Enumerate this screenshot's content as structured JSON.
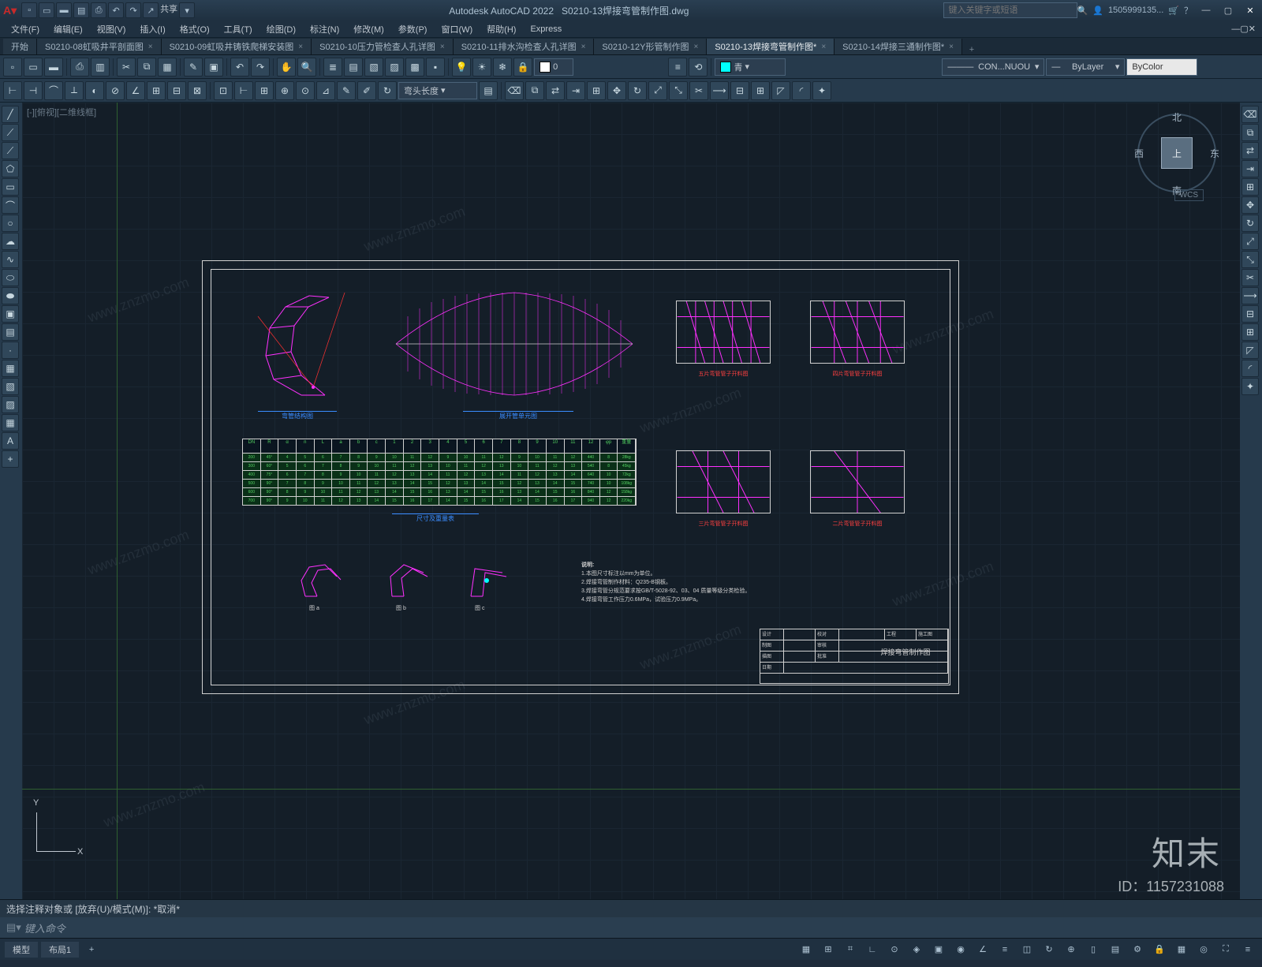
{
  "app": {
    "title": "Autodesk AutoCAD 2022",
    "filename": "S0210-13焊接弯管制作图.dwg",
    "share": "共享"
  },
  "search": {
    "placeholder": "键入关键字或短语",
    "user": "1505999135..."
  },
  "menu": [
    "文件(F)",
    "编辑(E)",
    "视图(V)",
    "插入(I)",
    "格式(O)",
    "工具(T)",
    "绘图(D)",
    "标注(N)",
    "修改(M)",
    "参数(P)",
    "窗口(W)",
    "帮助(H)",
    "Express"
  ],
  "tabs": {
    "start": "开始",
    "items": [
      {
        "label": "S0210-08虹吸井平剖面图"
      },
      {
        "label": "S0210-09虹吸井铸铁爬梯安装图"
      },
      {
        "label": "S0210-10压力管检查人孔详图"
      },
      {
        "label": "S0210-11排水沟检查人孔详图"
      },
      {
        "label": "S0210-12Y形管制作图"
      },
      {
        "label": "S0210-13焊接弯管制作图*"
      },
      {
        "label": "S0210-14焊接三通制作图*"
      }
    ],
    "active_index": 5
  },
  "props": {
    "linetype": "CON...NUOU",
    "lineweight": "ByLayer",
    "color": "ByColor",
    "layer_color": "青",
    "layer_num": "0",
    "combo": "弯头长度"
  },
  "viewport": {
    "label": "[-][俯视][二维线框]"
  },
  "viewcube": {
    "top": "上",
    "n": "北",
    "s": "南",
    "e": "东",
    "w": "西",
    "wcs": "WCS"
  },
  "drawing": {
    "labels": {
      "elbow": "弯管结构图",
      "unfold": "展开管单元图",
      "table": "尺寸及重量表",
      "db1": "五片弯管管子开料图",
      "db2": "四片弯管管子开料图",
      "db3": "三片弯管管子开料图",
      "db4": "二片弯管管子开料图",
      "sa": "图 a",
      "sb": "图 b",
      "sc": "图 c"
    },
    "notes": {
      "title": "说明:",
      "n1": "1.本图尺寸标注以mm为单位。",
      "n2": "2.焊接弯管制作材料：Q235-B钢板。",
      "n3": "3.焊接弯管分规范要求按GB/T-5028-92、03、04 质量等级分类检验。",
      "n4": "4.焊接弯管工作压力0.6MPa，试验压力0.9MPa。"
    },
    "title_block": {
      "project": "工程",
      "stage": "施工图",
      "main": "焊接弯管制作图"
    }
  },
  "cmd": {
    "history": "选择注释对象或  [放弃(U)/模式(M)]:  *取消*",
    "prompt": "键入命令"
  },
  "status": {
    "model": "模型",
    "layout": "布局1"
  },
  "watermark": {
    "brand": "知末",
    "id": "ID：1157231088",
    "url": "www.znzmo.com"
  }
}
